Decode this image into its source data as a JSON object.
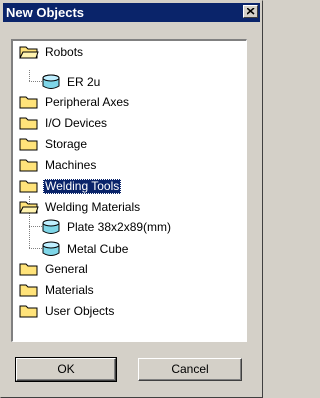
{
  "window": {
    "title": "New Objects",
    "close_label": "×"
  },
  "tree": {
    "nodes": [
      {
        "label": "Robots",
        "icon": "folder-open-icon"
      },
      {
        "label": "ER 2u",
        "icon": "object-icon"
      },
      {
        "label": "Peripheral Axes",
        "icon": "folder-icon"
      },
      {
        "label": "I/O Devices",
        "icon": "folder-icon"
      },
      {
        "label": "Storage",
        "icon": "folder-icon"
      },
      {
        "label": "Machines",
        "icon": "folder-icon"
      },
      {
        "label": "Welding Tools",
        "icon": "folder-icon",
        "selected": true
      },
      {
        "label": "Welding Materials",
        "icon": "folder-open-icon"
      },
      {
        "label": "Plate 38x2x89(mm)",
        "icon": "object-icon"
      },
      {
        "label": "Metal Cube",
        "icon": "object-icon"
      },
      {
        "label": "General",
        "icon": "folder-icon"
      },
      {
        "label": "Materials",
        "icon": "folder-icon"
      },
      {
        "label": "User Objects",
        "icon": "folder-icon"
      }
    ]
  },
  "buttons": {
    "ok": "OK",
    "cancel": "Cancel"
  },
  "colors": {
    "titlebar": "#0a246a",
    "selection": "#0a246a",
    "folder": "#ffe37a",
    "object": "#7fd6e8"
  }
}
